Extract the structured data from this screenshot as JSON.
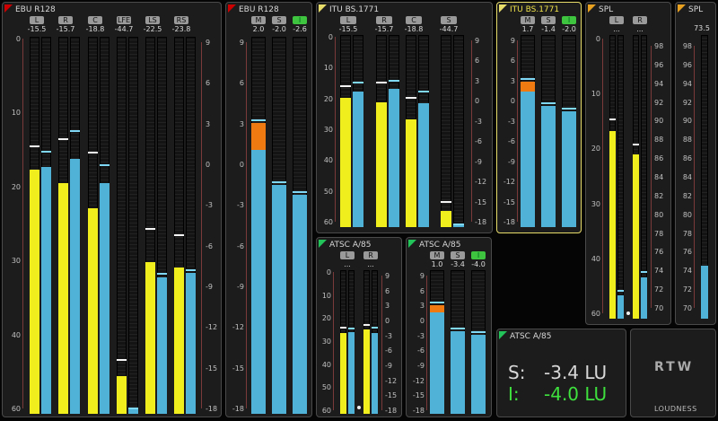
{
  "colors": {
    "yellow": "#f0ee1c",
    "blue": "#4fb2d6",
    "orange": "#f07a12",
    "green": "#3ec43e",
    "red_corner": "#cc0000",
    "yellow_corner": "#e8dc6a",
    "orange_corner": "#e8a020",
    "green_corner": "#22c45a"
  },
  "panels": [
    {
      "id": "ebu1",
      "title": "EBU R128",
      "corner": "red",
      "channels": [
        {
          "label": "L",
          "value": "-15.5",
          "yellow": 0.648,
          "blue": 0.654,
          "peak_y": 0.706,
          "peak_b": 0.694
        },
        {
          "label": "R",
          "value": "-15.7",
          "yellow": 0.612,
          "blue": 0.677,
          "peak_y": 0.727,
          "peak_b": 0.747
        },
        {
          "label": "C",
          "value": "-18.8",
          "yellow": 0.545,
          "blue": 0.613,
          "peak_y": 0.691,
          "peak_b": 0.658
        },
        {
          "label": "LFE",
          "value": "-44.7",
          "yellow": 0.099,
          "blue": 0.012,
          "peak_y": 0.14,
          "peak_b": 0.012
        },
        {
          "label": "LS",
          "value": "-22.5",
          "yellow": 0.403,
          "blue": 0.362,
          "peak_y": 0.489,
          "peak_b": 0.368
        },
        {
          "label": "RS",
          "value": "-23.8",
          "yellow": 0.388,
          "blue": 0.375,
          "peak_y": 0.471,
          "peak_b": 0.379
        }
      ],
      "scale_left": [
        "0",
        "10",
        "20",
        "30",
        "40",
        "60"
      ],
      "scale_right": [
        "9",
        "6",
        "3",
        "0",
        "-3",
        "-6",
        "-9",
        "-12",
        "-15",
        "-18"
      ]
    },
    {
      "id": "ebu2",
      "title": "EBU R128",
      "corner": "red",
      "channels": [
        {
          "label": "M",
          "value": "2.0",
          "blue": 0.7,
          "orange": 0.072
        },
        {
          "label": "S",
          "value": "-2.0",
          "blue": 0.608
        },
        {
          "label": "I",
          "value": "-2.6",
          "blue": 0.582,
          "green": true
        }
      ],
      "scale_left": [
        "9",
        "6",
        "3",
        "0",
        "-3",
        "-6",
        "-9",
        "-12",
        "-15",
        "-18"
      ]
    },
    {
      "id": "itu1",
      "title": "ITU BS.1771",
      "corner": "yellow",
      "channels": [
        {
          "label": "L",
          "value": "-15.5",
          "yellow": 0.673,
          "blue": 0.707,
          "peak_y": 0.727,
          "peak_b": 0.746
        },
        {
          "label": "R",
          "value": "-15.7",
          "yellow": 0.648,
          "blue": 0.72,
          "peak_y": 0.746,
          "peak_b": 0.757
        },
        {
          "label": "C",
          "value": "-18.8",
          "yellow": 0.562,
          "blue": 0.647,
          "peak_y": 0.668,
          "peak_b": 0.699
        },
        {
          "label": "S",
          "value": "-44.7",
          "yellow": 0.086,
          "blue": 0.008,
          "peak_y": 0.125,
          "peak_b": 0.008
        }
      ],
      "scale_left": [
        "0",
        "10",
        "20",
        "30",
        "40",
        "50",
        "60"
      ],
      "scale_right": [
        "9",
        "6",
        "3",
        "0",
        "-3",
        "-6",
        "-9",
        "-12",
        "-15",
        "-18"
      ]
    },
    {
      "id": "itu2",
      "title": "ITU BS.1771",
      "corner": "yellow",
      "selected": true,
      "channels": [
        {
          "label": "M",
          "value": "1.7",
          "blue": 0.707,
          "orange": 0.05
        },
        {
          "label": "S",
          "value": "-1.4",
          "blue": 0.63
        },
        {
          "label": "I",
          "value": "-2.0",
          "blue": 0.603,
          "green": true
        }
      ],
      "scale_left": [
        "9",
        "6",
        "3",
        "0",
        "-3",
        "-6",
        "-9",
        "-12",
        "-15",
        "-18"
      ]
    },
    {
      "id": "spl1",
      "title": "SPL",
      "corner": "orange",
      "channels": [
        {
          "label": "L",
          "value": "...",
          "yellow": 0.66,
          "blue": 0.083,
          "peak_y": 0.7,
          "peak_b": 0.095
        },
        {
          "label": "R",
          "value": "...",
          "yellow": 0.58,
          "blue": 0.145,
          "peak_y": 0.612,
          "peak_b": 0.162
        }
      ],
      "scale_left": [
        "0",
        "10",
        "20",
        "30",
        "40",
        "60"
      ],
      "scale_right": [
        "98",
        "96",
        "94",
        "92",
        "90",
        "88",
        "86",
        "84",
        "82",
        "80",
        "78",
        "76",
        "74",
        "72",
        "70"
      ]
    },
    {
      "id": "spl2",
      "title": "SPL",
      "value": "73.5",
      "corner": "orange",
      "bar": 0.186,
      "scale_left": [
        "98",
        "96",
        "94",
        "92",
        "90",
        "88",
        "86",
        "84",
        "82",
        "80",
        "78",
        "76",
        "74",
        "72",
        "70"
      ]
    },
    {
      "id": "atsc1",
      "title": "ATSC A/85",
      "corner": "green",
      "channels": [
        {
          "label": "L",
          "value": "...",
          "yellow": 0.56,
          "blue": 0.57,
          "peak_y": 0.595,
          "peak_b": 0.585
        },
        {
          "label": "R",
          "value": "...",
          "yellow": 0.59,
          "blue": 0.56,
          "peak_y": 0.61,
          "peak_b": 0.595
        }
      ],
      "scale_left": [
        "0",
        "10",
        "20",
        "30",
        "40",
        "50",
        "60"
      ],
      "scale_right": [
        "9",
        "6",
        "3",
        "0",
        "-3",
        "-6",
        "-9",
        "-12",
        "-15",
        "-18"
      ]
    },
    {
      "id": "atsc2",
      "title": "ATSC A/85",
      "corner": "green",
      "channels": [
        {
          "label": "M",
          "value": "1.0",
          "blue": 0.706,
          "orange": 0.05
        },
        {
          "label": "S",
          "value": "-3.4",
          "blue": 0.576
        },
        {
          "label": "I",
          "value": "-4.0",
          "blue": 0.553,
          "green": true
        }
      ],
      "scale_left": [
        "9",
        "6",
        "3",
        "0",
        "-3",
        "-6",
        "-9",
        "-12",
        "-15",
        "-18"
      ]
    }
  ],
  "readout": {
    "title": "ATSC A/85",
    "s_label": "S:",
    "s_value": "-3.4 LU",
    "i_label": "I:",
    "i_value": "-4.0 LU"
  },
  "logo": {
    "text": "RTW",
    "sub": "LOUDNESS"
  }
}
